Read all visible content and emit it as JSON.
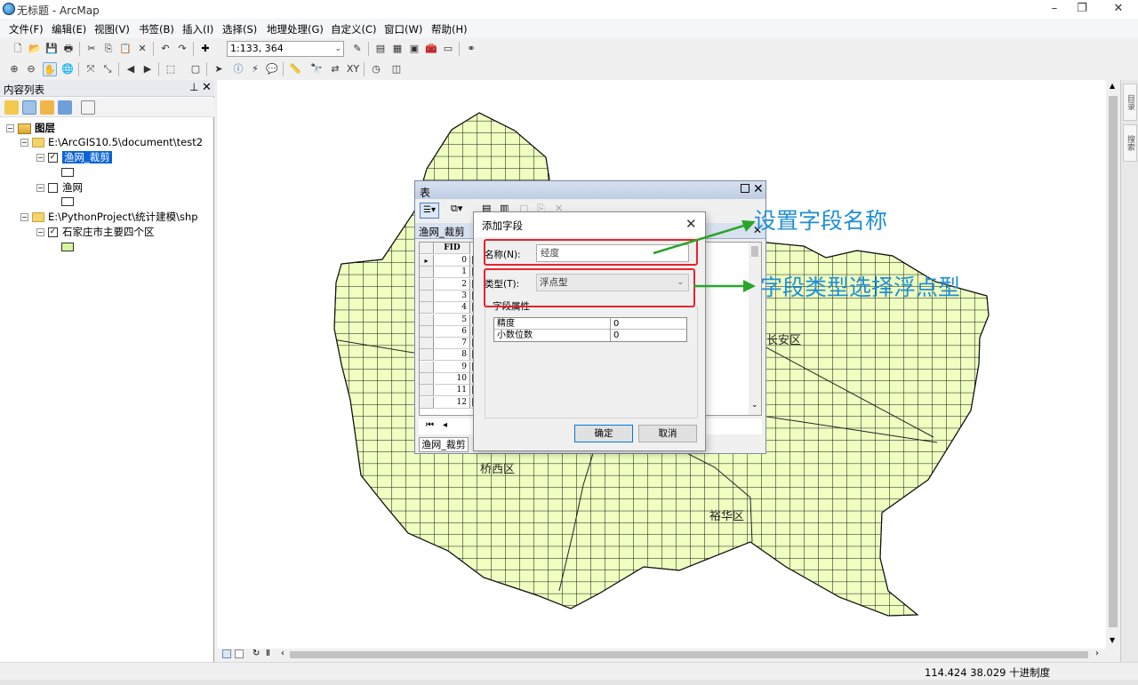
{
  "window": {
    "title": "无标题 - ArcMap"
  },
  "menu": [
    "文件(F)",
    "编辑(E)",
    "视图(V)",
    "书签(B)",
    "插入(I)",
    "选择(S)",
    "地理处理(G)",
    "自定义(C)",
    "窗口(W)",
    "帮助(H)"
  ],
  "toolbar": {
    "scale_value": "1:133, 364"
  },
  "toc": {
    "title": "内容列表",
    "root_label": "图层",
    "folder1": "E:\\ArcGIS10.5\\document\\test2",
    "layer1": "渔网_裁剪",
    "layer2": "渔网",
    "folder2": "E:\\PythonProject\\统计建模\\shp",
    "layer3": "石家庄市主要四个区"
  },
  "map_labels": {
    "changan": "长安区",
    "qiaoxi": "桥西区",
    "yuhua": "裕华区"
  },
  "table_window": {
    "title": "表",
    "tab_name": "渔网_裁剪",
    "column": "FID",
    "rows": [
      "0",
      "1",
      "2",
      "3",
      "4",
      "5",
      "6",
      "7",
      "8",
      "9",
      "10",
      "11",
      "12"
    ],
    "bottom_tab": "渔网_裁剪"
  },
  "dialog": {
    "title": "添加字段",
    "name_label": "名称(N):",
    "name_value": "经度",
    "type_label": "类型(T):",
    "type_value": "浮点型",
    "group_label": "字段属性",
    "props": [
      {
        "name": "精度",
        "value": "0"
      },
      {
        "name": "小数位数",
        "value": "0"
      }
    ],
    "ok_label": "确定",
    "cancel_label": "取消"
  },
  "annotations": {
    "name_note": "设置字段名称",
    "type_note": "字段类型选择浮点型"
  },
  "statusbar": {
    "coords": "114.424  38.029 十进制度"
  },
  "right_dock": {
    "tab1": "目录",
    "tab2": "搜索"
  },
  "colors": {
    "map_fill": "#eeffc0",
    "highlight": "#e8232c",
    "annotation_text": "#1f8ed6",
    "arrow": "#2aa52a",
    "selection": "#0a64d6"
  }
}
